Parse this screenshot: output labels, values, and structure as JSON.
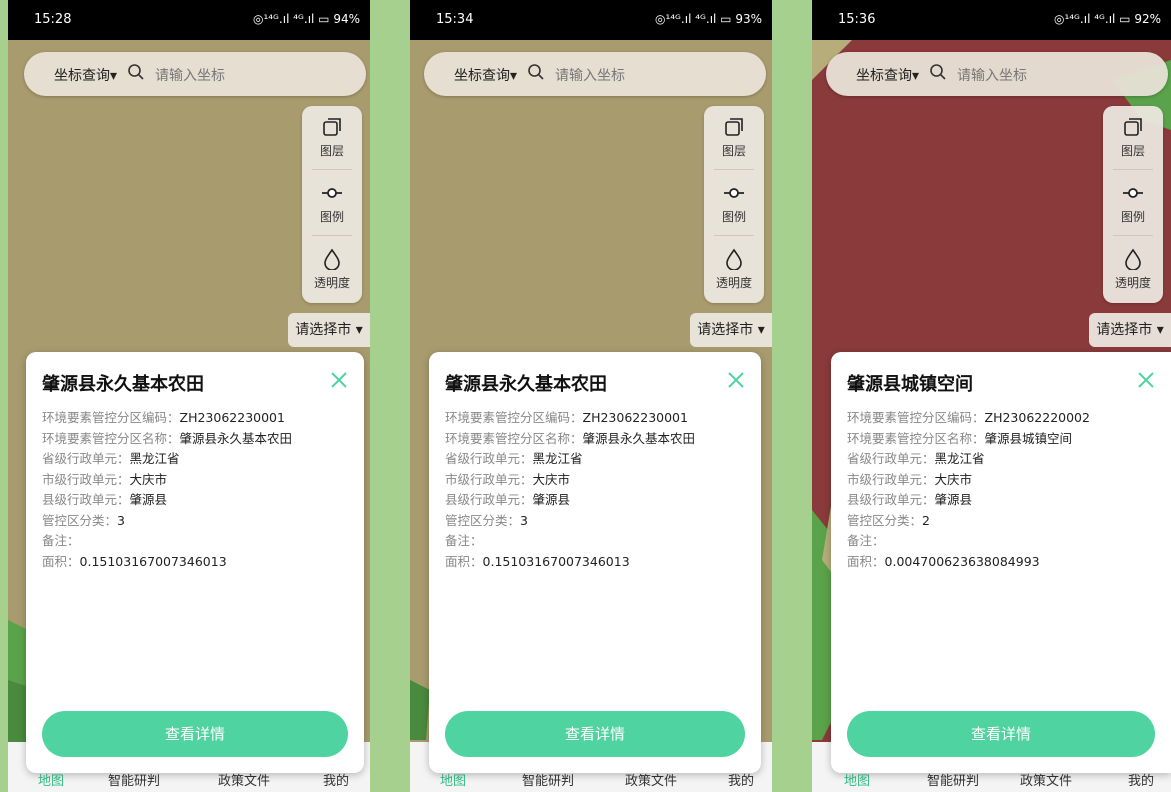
{
  "screens": [
    {
      "status_time": "15:28",
      "status_icons": "◎¹⁴ᴳ.ıl ⁴ᴳ.ıl ▭ 94%",
      "search": {
        "mode_label": "坐标查询▾",
        "placeholder": "请输入坐标"
      },
      "tools": [
        {
          "label": "图层"
        },
        {
          "label": "图例"
        },
        {
          "label": "透明度"
        }
      ],
      "city_select": "请选择市 ▾",
      "popup": {
        "title": "肇源县永久基本农田",
        "fields": [
          {
            "key": "环境要素管控分区编码：",
            "value": "ZH23062230001"
          },
          {
            "key": "环境要素管控分区名称：",
            "value": "肇源县永久基本农田"
          },
          {
            "key": "省级行政单元：",
            "value": "黑龙江省"
          },
          {
            "key": "市级行政单元：",
            "value": "大庆市"
          },
          {
            "key": "县级行政单元：",
            "value": "肇源县"
          },
          {
            "key": "管控区分类：",
            "value": "3"
          },
          {
            "key": "备注：",
            "value": ""
          },
          {
            "key": "面积：",
            "value": "0.15103167007346013"
          }
        ],
        "detail_button": "查看详情"
      },
      "nav": [
        "地图",
        "智能研判",
        "政策文件",
        "我的"
      ]
    },
    {
      "status_time": "15:34",
      "status_icons": "◎¹⁴ᴳ.ıl ⁴ᴳ.ıl ▭ 93%",
      "search": {
        "mode_label": "坐标查询▾",
        "placeholder": "请输入坐标"
      },
      "tools": [
        {
          "label": "图层"
        },
        {
          "label": "图例"
        },
        {
          "label": "透明度"
        }
      ],
      "city_select": "请选择市 ▾",
      "popup": {
        "title": "肇源县永久基本农田",
        "fields": [
          {
            "key": "环境要素管控分区编码：",
            "value": "ZH23062230001"
          },
          {
            "key": "环境要素管控分区名称：",
            "value": "肇源县永久基本农田"
          },
          {
            "key": "省级行政单元：",
            "value": "黑龙江省"
          },
          {
            "key": "市级行政单元：",
            "value": "大庆市"
          },
          {
            "key": "县级行政单元：",
            "value": "肇源县"
          },
          {
            "key": "管控区分类：",
            "value": "3"
          },
          {
            "key": "备注：",
            "value": ""
          },
          {
            "key": "面积：",
            "value": "0.15103167007346013"
          }
        ],
        "detail_button": "查看详情"
      },
      "nav": [
        "地图",
        "智能研判",
        "政策文件",
        "我的"
      ]
    },
    {
      "status_time": "15:36",
      "status_icons": "◎¹⁴ᴳ.ıl ⁴ᴳ.ıl ▭ 92%",
      "search": {
        "mode_label": "坐标查询▾",
        "placeholder": "请输入坐标"
      },
      "tools": [
        {
          "label": "图层"
        },
        {
          "label": "图例"
        },
        {
          "label": "透明度"
        }
      ],
      "city_select": "请选择市 ▾",
      "popup": {
        "title": "肇源县城镇空间",
        "fields": [
          {
            "key": "环境要素管控分区编码：",
            "value": "ZH23062220002"
          },
          {
            "key": "环境要素管控分区名称：",
            "value": "肇源县城镇空间"
          },
          {
            "key": "省级行政单元：",
            "value": "黑龙江省"
          },
          {
            "key": "市级行政单元：",
            "value": "大庆市"
          },
          {
            "key": "县级行政单元：",
            "value": "肇源县"
          },
          {
            "key": "管控区分类：",
            "value": "2"
          },
          {
            "key": "备注：",
            "value": ""
          },
          {
            "key": "面积：",
            "value": "0.004700623638084993"
          }
        ],
        "detail_button": "查看详情"
      },
      "nav": [
        "地图",
        "智能研判",
        "政策文件",
        "我的"
      ]
    }
  ],
  "colors": {
    "page_bg": "#a5d08e",
    "map_olive": "#a89c6e",
    "map_red": "#8a3a3a",
    "map_green": "#5aa34a",
    "accent": "#4fd3a1",
    "close_icon": "#4fd3a1"
  },
  "icons": [
    "search-icon",
    "layers-icon",
    "legend-icon",
    "opacity-drop-icon",
    "close-icon"
  ]
}
